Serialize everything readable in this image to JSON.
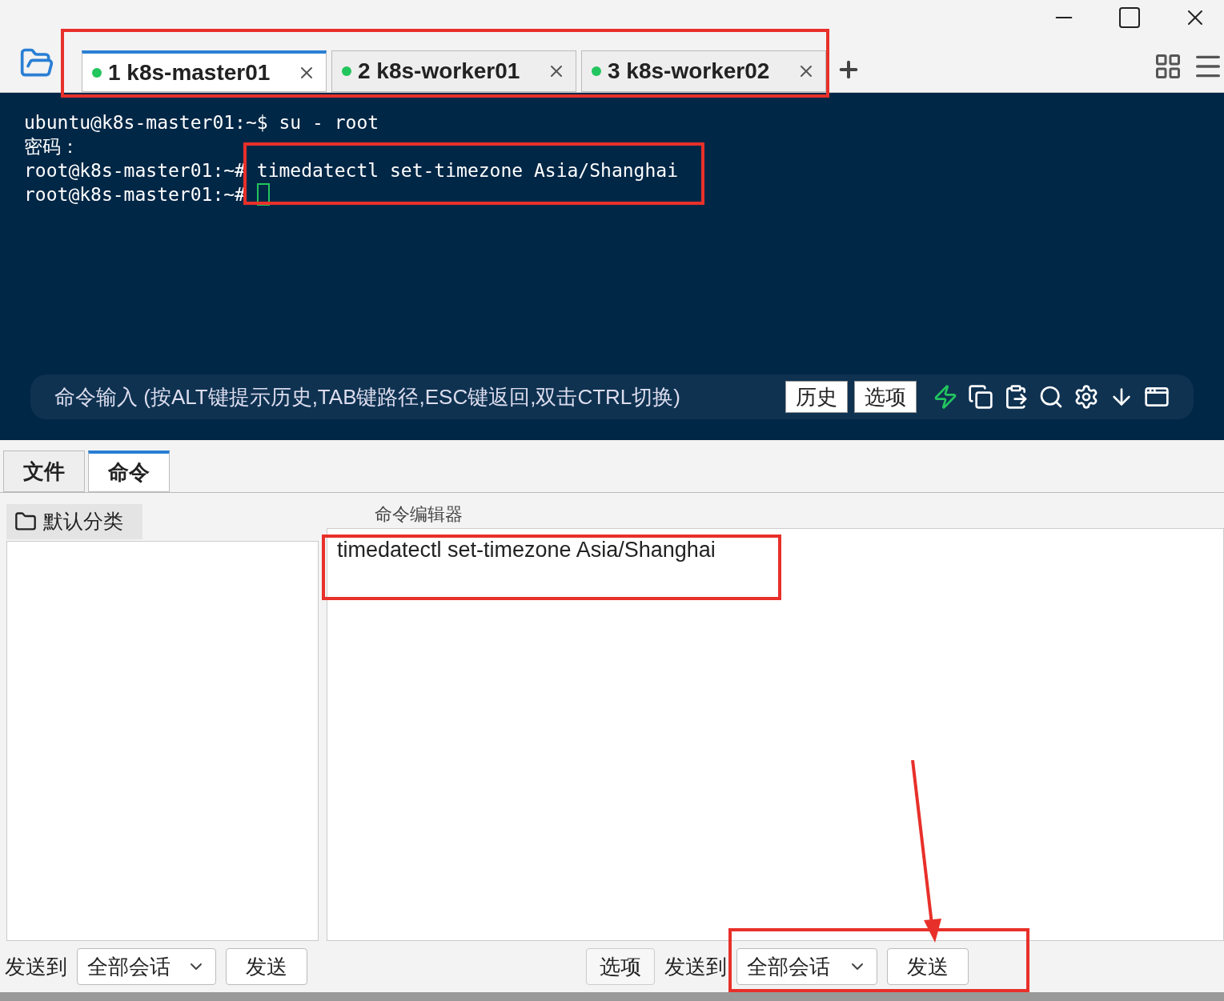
{
  "session_tabs": [
    {
      "number": "1",
      "label": "k8s-master01",
      "selected": true,
      "connected": true
    },
    {
      "number": "2",
      "label": "k8s-worker01",
      "selected": false,
      "connected": true
    },
    {
      "number": "3",
      "label": "k8s-worker02",
      "selected": false,
      "connected": true
    }
  ],
  "terminal": {
    "lines": [
      "ubuntu@k8s-master01:~$ su - root",
      "密码：",
      "root@k8s-master01:~# timedatectl set-timezone Asia/Shanghai",
      "root@k8s-master01:~# "
    ]
  },
  "command_bar": {
    "placeholder": "命令输入 (按ALT键提示历史,TAB键路径,ESC键返回,双击CTRL切换)",
    "buttons": [
      "历史",
      "选项"
    ]
  },
  "panel_tabs": [
    {
      "label": "文件",
      "selected": false
    },
    {
      "label": "命令",
      "selected": true
    }
  ],
  "category": {
    "label": "默认分类"
  },
  "editor": {
    "title": "命令编辑器",
    "value": "timedatectl set-timezone Asia/Shanghai"
  },
  "left_footer": {
    "send_to": "发送到",
    "target": "全部会话",
    "send": "发送"
  },
  "right_footer": {
    "options": "选项",
    "send_to": "发送到",
    "target": "全部会话",
    "send": "发送"
  },
  "annotations": [
    {
      "kind": "box"
    },
    {
      "kind": "box"
    },
    {
      "kind": "box"
    },
    {
      "kind": "box"
    },
    {
      "kind": "arrow"
    }
  ]
}
